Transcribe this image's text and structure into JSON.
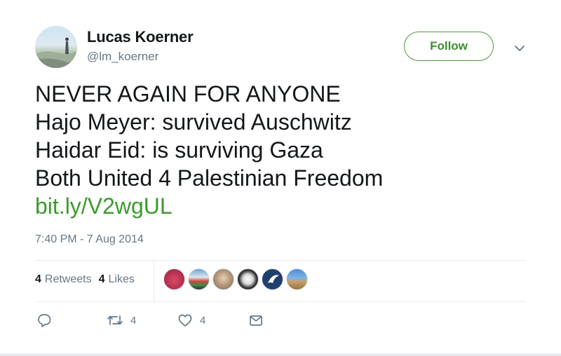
{
  "user": {
    "name": "Lucas Koerner",
    "handle": "@lm_koerner"
  },
  "follow_label": "Follow",
  "tweet": {
    "lines": [
      "NEVER AGAIN FOR ANYONE",
      "Hajo Meyer: survived Auschwitz",
      "Haidar Eid: is surviving Gaza",
      "Both United 4 Palestinian Freedom"
    ],
    "link": "bit.ly/V2wgUL"
  },
  "timestamp": "7:40 PM - 7 Aug 2014",
  "stats": {
    "retweets_count": "4",
    "retweets_label": "Retweets",
    "likes_count": "4",
    "likes_label": "Likes"
  },
  "actions": {
    "retweet_count": "4",
    "like_count": "4"
  },
  "colors": {
    "accent": "#3b8f2e",
    "link": "#3b9a2c",
    "text": "#14171a",
    "muted": "#657786",
    "divider": "#e6ecf0"
  },
  "icons": [
    "chevron-down-icon",
    "reply-icon",
    "retweet-icon",
    "heart-icon",
    "message-icon"
  ]
}
